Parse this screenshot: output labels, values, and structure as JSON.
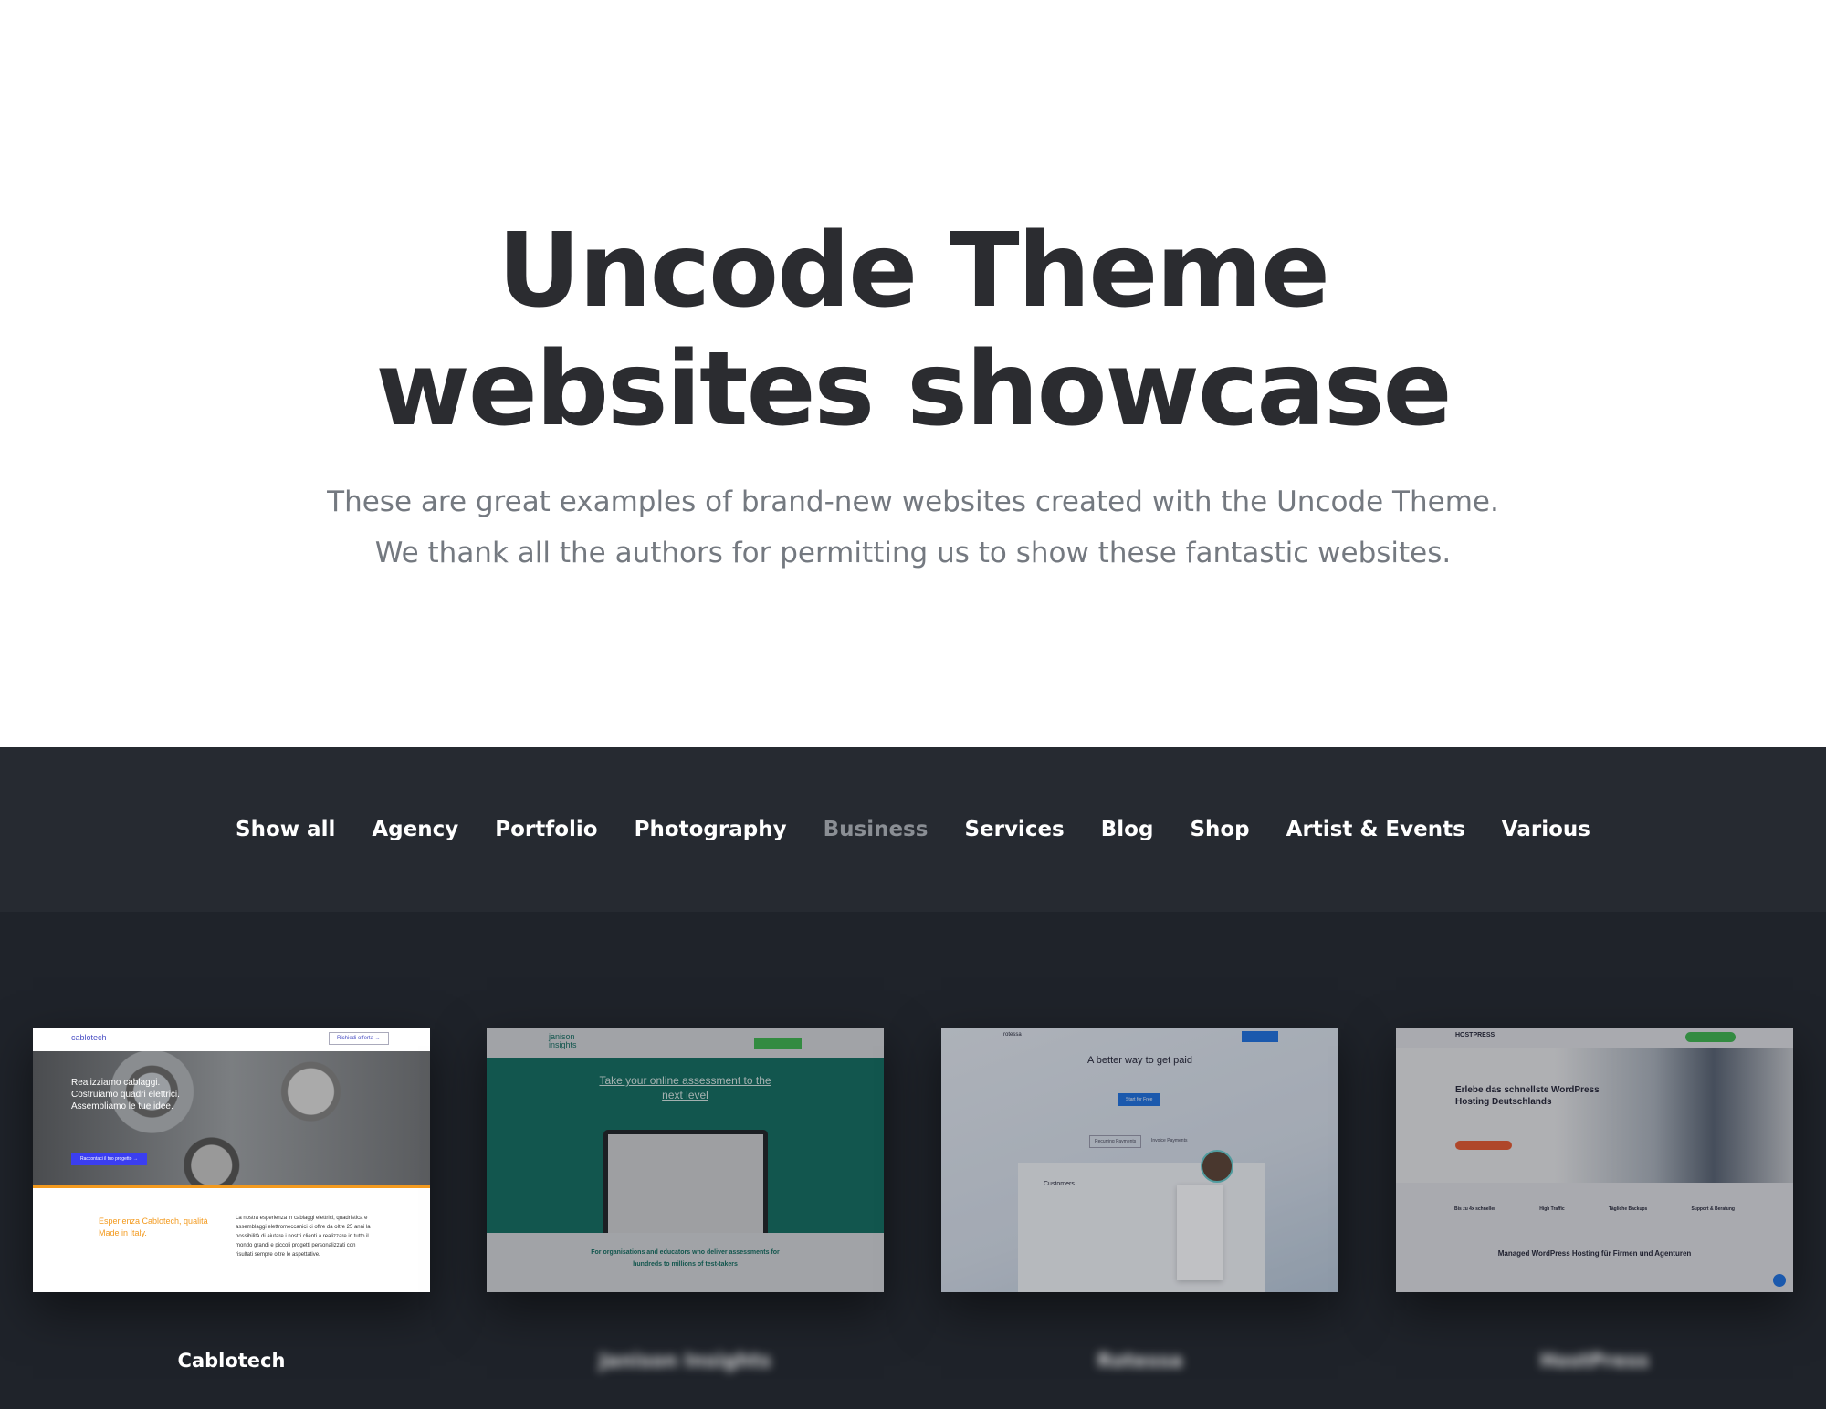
{
  "hero": {
    "title_line1": "Uncode Theme",
    "title_line2": "websites showcase",
    "subtitle_line1": "These are great examples of brand-new websites created with the Uncode Theme.",
    "subtitle_line2": "We thank all the authors for permitting us to show these fantastic websites."
  },
  "nav": {
    "active": "Business",
    "items": [
      "Show all",
      "Agency",
      "Portfolio",
      "Photography",
      "Business",
      "Services",
      "Blog",
      "Shop",
      "Artist & Events",
      "Various"
    ]
  },
  "sites": [
    {
      "name": "Cablotech",
      "logo": "cablotech",
      "cta": "Richiedi offerta →",
      "headline": "Realizziamo cablaggi. Costruiamo quadri elettrici. Assembliamo le tue idee.",
      "button": "Raccontaci il tuo progetto →",
      "tagline": "Esperienza Cablotech, qualità Made in Italy.",
      "body": "La nostra esperienza in cablaggi elettrici, quadristica e assemblaggi elettromeccanici ci offre da oltre 25 anni la possibilità di aiutare i nostri clienti a realizzare in tutto il mondo grandi e piccoli progetti personalizzati con risultati sempre oltre le aspettative.",
      "accent": "#f39a1e"
    },
    {
      "name": "Janison Insights",
      "logo": "janison insights",
      "headline": "Take your online assessment to the next level",
      "footer": "For organisations and educators who deliver assessments for hundreds to millions of test-takers",
      "accent": "#0f6b5c"
    },
    {
      "name": "Rotessa",
      "logo": "rotessa",
      "headline": "A better way to get paid",
      "button": "Start for Free",
      "panel": "Customers",
      "tab1": "Recurring Payments",
      "tab2": "Invoice Payments",
      "accent": "#1b6fe0"
    },
    {
      "name": "HostPress",
      "logo": "HOSTPRESS",
      "headline": "Erlebe das schnellste WordPress Hosting Deutschlands",
      "features": [
        "Bis zu 4x schneller",
        "High Traffic",
        "Tägliche Backups",
        "Support & Beratung"
      ],
      "footer": "Managed WordPress Hosting für Firmen und Agenturen",
      "accent": "#3cb54a"
    }
  ]
}
